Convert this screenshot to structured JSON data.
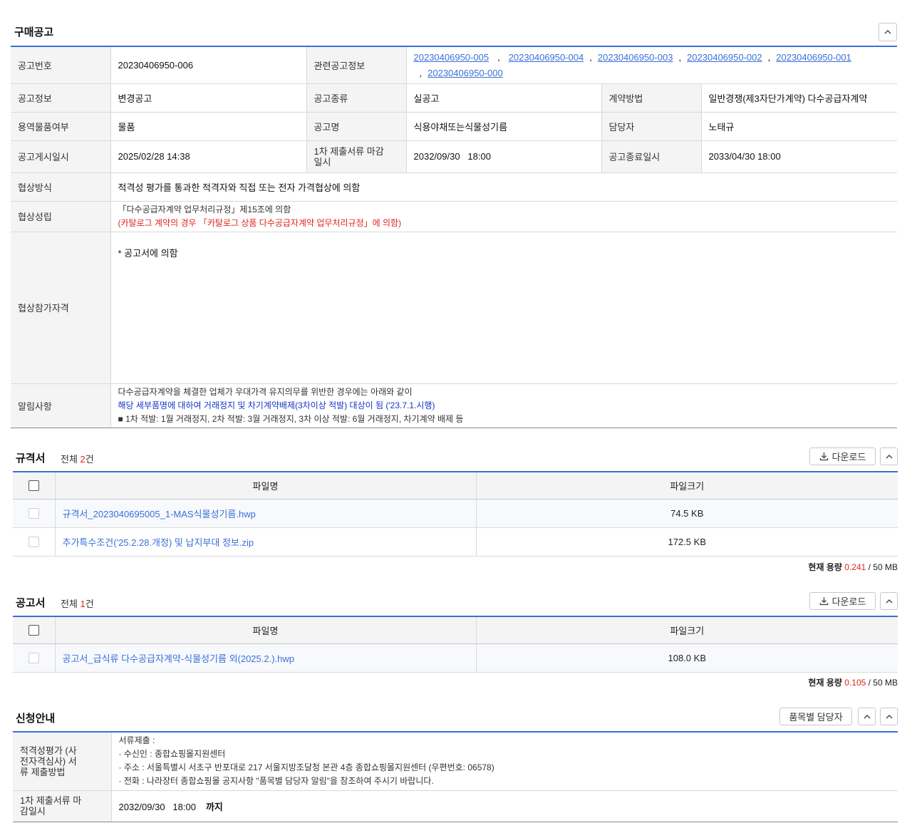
{
  "purchase": {
    "title": "구매공고",
    "fields": {
      "notice_no_label": "공고번호",
      "notice_no": "20230406950-006",
      "related_label": "관련공고정보",
      "related": [
        "20230406950-005",
        "20230406950-004",
        "20230406950-003",
        "20230406950-002",
        "20230406950-001",
        "20230406950-000"
      ],
      "notice_info_label": "공고정보",
      "notice_info": "변경공고",
      "notice_type_label": "공고종류",
      "notice_type": "실공고",
      "contract_method_label": "계약방법",
      "contract_method": "일반경쟁(제3자단가계약) 다수공급자계약",
      "goods_label": "용역물품여부",
      "goods": "물품",
      "notice_name_label": "공고명",
      "notice_name": "식용야채또는식물성기름",
      "manager_label": "담당자",
      "manager": "노태규",
      "post_date_label": "공고게시일시",
      "post_date": "2025/02/28 14:38",
      "first_deadline_label": "1차 제출서류 마감일시",
      "first_deadline": "2032/09/30   18:00",
      "end_date_label": "공고종료일시",
      "end_date": "2033/04/30 18:00",
      "nego_method_label": "협상방식",
      "nego_method": "적격성 평가를 통과한 적격자와 직접 또는 전자 가격협상에 의함",
      "nego_estab_label": "협상성립",
      "nego_estab_line1": "「다수공급자계약 업무처리규정」제15조에 의함",
      "nego_estab_line2": "(카탈로그 계약의 경우 「카탈로그 상품 다수공급자계약 업무처리규정」에 의함)",
      "nego_qual_label": "협상참가자격",
      "nego_qual": "* 공고서에 의함",
      "notice_label": "알림사항",
      "notice_line1": "다수공급자계약을 체결한 업체가 우대가격 유지의무를 위반한 경우에는 아래와 같이",
      "notice_line2": "해당 세부품명에 대하여 거래정지 및 차기계약배제(3차이상 적발) 대상이 됨 ('23.7.1.시행)",
      "notice_line3": "■ 1차 적발: 1월 거래정지, 2차 적발: 3월 거래정지, 3차 이상 적발: 6월 거래정지, 차기계약 배제 등"
    }
  },
  "spec": {
    "title": "규격서",
    "count_prefix": "전체",
    "count": "2",
    "count_suffix": "건",
    "download_label": "다운로드",
    "col_filename": "파일명",
    "col_filesize": "파일크기",
    "files": [
      {
        "name": "규격서_2023040695005_1-MAS식물성기름.hwp",
        "size": "74.5 KB"
      },
      {
        "name": "추가특수조건('25.2.28.개정) 및 납지부대 정보.zip",
        "size": "172.5 KB"
      }
    ],
    "usage_label": "현재 용량",
    "usage_current": "0.241",
    "usage_total": "/ 50 MB"
  },
  "announce": {
    "title": "공고서",
    "count_prefix": "전체",
    "count": "1",
    "count_suffix": "건",
    "download_label": "다운로드",
    "col_filename": "파일명",
    "col_filesize": "파일크기",
    "files": [
      {
        "name": "공고서_급식류 다수공급자계약-식물성기름 외(2025.2.).hwp",
        "size": "108.0 KB"
      }
    ],
    "usage_label": "현재 용량",
    "usage_current": "0.105",
    "usage_total": "/ 50 MB"
  },
  "apply": {
    "title": "신청안내",
    "manager_btn": "품목별 담당자",
    "method_label": "적격성평가 (사전자격심사) 서류 제출방법",
    "method_line1": "서류제출 :",
    "method_line2": "· 수신인 : 종합쇼핑몰지원센터",
    "method_line3": "· 주소 : 서울특별시 서초구 반포대로 217 서울지방조달청 본관 4층 종합쇼핑몰지원센터 (우편번호: 06578)",
    "method_line4": "· 전화 : 나라장터 종합쇼핑몰 공지사항 \"품목별 담당자 알림\"을 참조하여 주시기 바랍니다.",
    "deadline_label": "1차 제출서류 마감일시",
    "deadline": "2032/09/30   18:00",
    "deadline_suffix": "까지"
  },
  "colors": {
    "accent_line": "#3a6fd8",
    "link": "#3a6fd8",
    "red": "#e0241b",
    "blue_notice": "#1434c8",
    "header_bg": "#f4f4f4"
  },
  "icons": [
    "chevron-up-icon",
    "download-icon"
  ]
}
